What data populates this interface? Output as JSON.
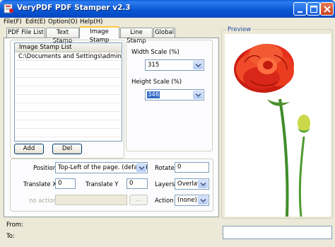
{
  "window": {
    "title": "VeryPDF PDF Stamper v2.3"
  },
  "menu": [
    "File(F)",
    "Edit(E)",
    "Option(O)",
    "Help(H)"
  ],
  "tabs": [
    {
      "label": "PDF File List"
    },
    {
      "label": "Text Stamp"
    },
    {
      "label": "Image Stamp"
    },
    {
      "label": "Line Stamp"
    },
    {
      "label": "Global"
    }
  ],
  "active_tab": "Image Stamp",
  "image_list": {
    "header": "Image Stamp List",
    "items": [
      "C:\\Documents and Settings\\admin\\My..."
    ]
  },
  "buttons": {
    "add": "Add",
    "del": "Del",
    "browse": "..."
  },
  "width_scale": {
    "label": "Width Scale (%)",
    "value": "315"
  },
  "height_scale": {
    "label": "Height Scale (%)",
    "value": "346"
  },
  "position": {
    "label": "Position",
    "value": "Top-Left of the page. (default)"
  },
  "rotate": {
    "label": "Rotate",
    "value": "0"
  },
  "translate_x": {
    "label": "Translate X",
    "value": "0"
  },
  "translate_y": {
    "label": "Translate Y",
    "value": "0"
  },
  "layers": {
    "label": "Layers",
    "value": "Overlay"
  },
  "no_action": {
    "label": "no action",
    "value": ""
  },
  "action": {
    "label": "Action",
    "value": "(none)"
  },
  "preview": {
    "label": "Preview"
  },
  "footer": {
    "from_label": "From:",
    "to_label": "To:"
  },
  "colors": {
    "titlebar": "#0a58d4",
    "tab_highlight": "#ffc83c",
    "selection": "#316ac5",
    "flower_red": "#e8301c",
    "stem_green": "#3f8c2a"
  }
}
